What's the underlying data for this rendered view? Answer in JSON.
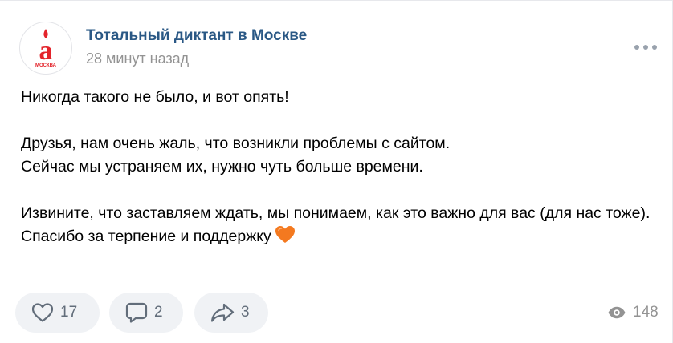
{
  "post": {
    "author": "Тотальный диктант в Москве",
    "time": "28 минут назад",
    "avatar": {
      "letter": "а",
      "caption": "МОСКВА",
      "color": "#e3242b",
      "icon": "totalny-diktant-logo"
    },
    "lines": [
      "Никогда такого не было, и вот опять!",
      "",
      "Друзья, нам очень жаль, что возникли проблемы с сайтом.",
      "Сейчас мы устраняем их, нужно чуть больше времени.",
      "",
      "Извините, что заставляем ждать, мы понимаем, как это важно для вас (для нас тоже).",
      "Спасибо за терпение и поддержку"
    ],
    "emoji": {
      "icon": "orange-heart-emoji",
      "color": "#f4791f"
    }
  },
  "actions": {
    "likes": "17",
    "comments": "2",
    "shares": "3",
    "views": "148",
    "icon_color": "#626d7a"
  }
}
